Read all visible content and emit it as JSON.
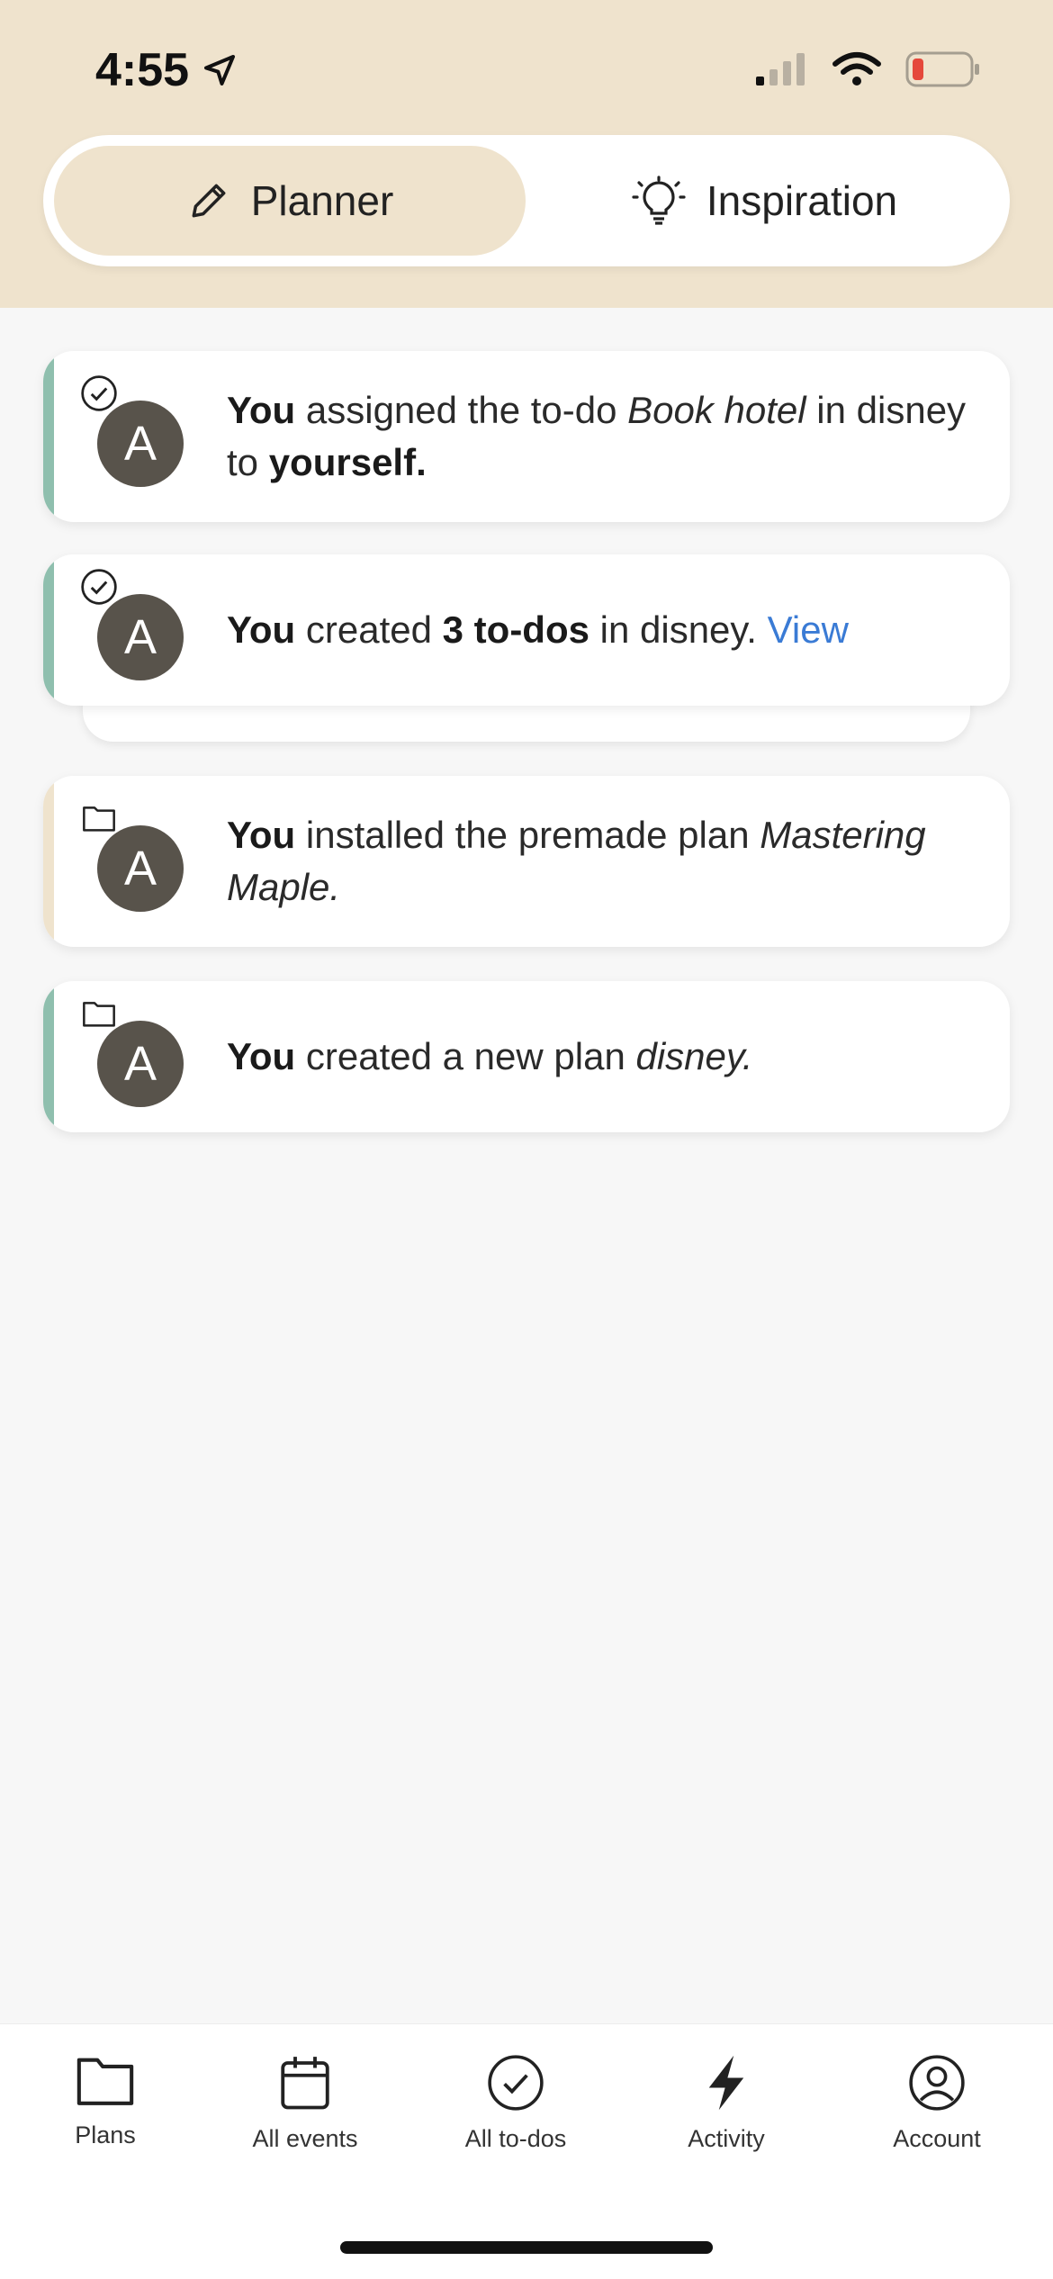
{
  "status_bar": {
    "time": "4:55"
  },
  "segmented_control": {
    "planner_label": "Planner",
    "inspiration_label": "Inspiration"
  },
  "colors": {
    "header_bg": "#efe3cd",
    "todo_bar": "#8fbfae",
    "plan_bar": "#efe3cd",
    "link": "#3a7bd5",
    "avatar": "#58534b"
  },
  "activity": [
    {
      "icon": "check-circle-icon",
      "avatar": "A",
      "actor": "You",
      "t1": " assigned the to-do ",
      "item": "Book hotel",
      "t2": " in disney to ",
      "target": "yourself."
    },
    {
      "icon": "check-circle-icon",
      "avatar": "A",
      "actor": "You",
      "t1": " created ",
      "count": "3 to-dos",
      "t2": " in disney. ",
      "link": "View"
    },
    {
      "icon": "folder-icon",
      "avatar": "A",
      "actor": "You",
      "t1": " installed the premade plan ",
      "item": "Mastering Maple."
    },
    {
      "icon": "folder-icon",
      "avatar": "A",
      "actor": "You",
      "t1": " created a new plan ",
      "item": "disney."
    }
  ],
  "tabbar": [
    {
      "label": "Plans",
      "icon": "folder-icon"
    },
    {
      "label": "All events",
      "icon": "calendar-icon"
    },
    {
      "label": "All to-dos",
      "icon": "check-circle-icon"
    },
    {
      "label": "Activity",
      "icon": "lightning-icon"
    },
    {
      "label": "Account",
      "icon": "account-icon"
    }
  ]
}
